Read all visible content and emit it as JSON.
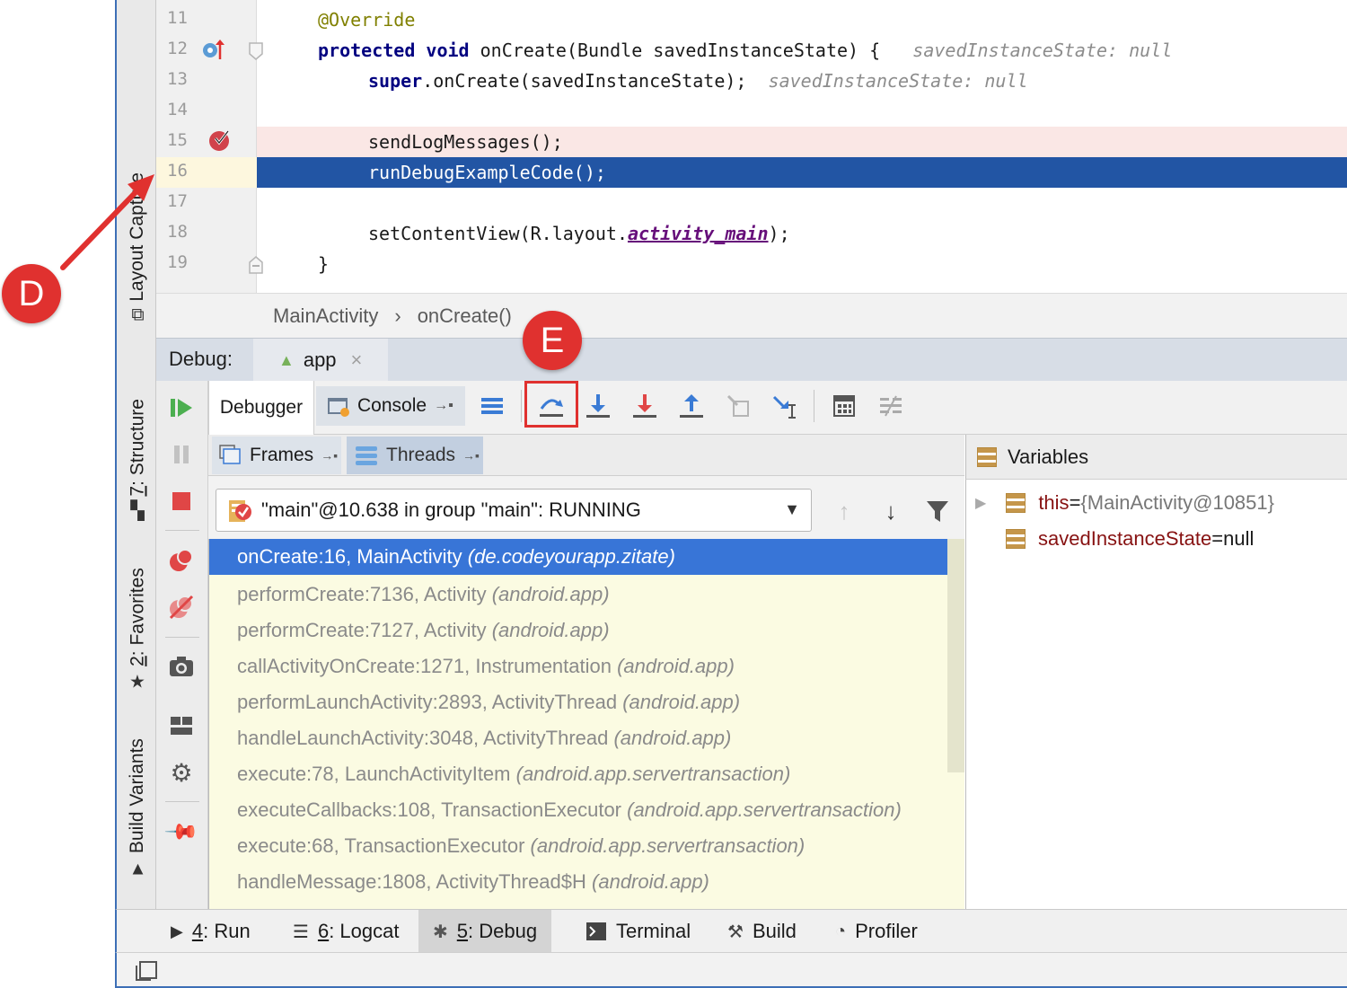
{
  "editor": {
    "lines": [
      {
        "num": "11",
        "text": "@Override"
      },
      {
        "num": "12",
        "kw1": "protected",
        "kw2": "void",
        "rest": " onCreate(Bundle savedInstanceState) {",
        "hint": "savedInstanceState: null"
      },
      {
        "num": "13",
        "kw1": "super",
        "rest": ".onCreate(savedInstanceState);",
        "hint": "savedInstanceState: null"
      },
      {
        "num": "14",
        "text": ""
      },
      {
        "num": "15",
        "text": "sendLogMessages();"
      },
      {
        "num": "16",
        "text": "runDebugExampleCode();"
      },
      {
        "num": "17",
        "text": ""
      },
      {
        "num": "18",
        "pre": "setContentView(R.layout.",
        "field": "activity_main",
        "post": ");"
      },
      {
        "num": "19",
        "text": "}"
      }
    ]
  },
  "breadcrumb": {
    "class": "MainActivity",
    "sep": "›",
    "method": "onCreate()"
  },
  "debug": {
    "label": "Debug:",
    "app_tab": "app",
    "tab_debugger": "Debugger",
    "tab_console": "Console",
    "tab_frames": "Frames",
    "tab_threads": "Threads",
    "thread": "\"main\"@10.638 in group \"main\": RUNNING",
    "frames": [
      {
        "method": "onCreate:16, MainActivity ",
        "pkg": "(de.codeyourapp.zitate)"
      },
      {
        "method": "performCreate:7136, Activity ",
        "pkg": "(android.app)"
      },
      {
        "method": "performCreate:7127, Activity ",
        "pkg": "(android.app)"
      },
      {
        "method": "callActivityOnCreate:1271, Instrumentation ",
        "pkg": "(android.app)"
      },
      {
        "method": "performLaunchActivity:2893, ActivityThread ",
        "pkg": "(android.app)"
      },
      {
        "method": "handleLaunchActivity:3048, ActivityThread ",
        "pkg": "(android.app)"
      },
      {
        "method": "execute:78, LaunchActivityItem ",
        "pkg": "(android.app.servertransaction)"
      },
      {
        "method": "executeCallbacks:108, TransactionExecutor ",
        "pkg": "(android.app.servertransaction)"
      },
      {
        "method": "execute:68, TransactionExecutor ",
        "pkg": "(android.app.servertransaction)"
      },
      {
        "method": "handleMessage:1808, ActivityThread$H ",
        "pkg": "(android.app)"
      }
    ],
    "variables_title": "Variables",
    "variables": [
      {
        "name": "this",
        "eq": " = ",
        "value": "{MainActivity@10851}"
      },
      {
        "name": "savedInstanceState",
        "eq": " = ",
        "value": "null"
      }
    ]
  },
  "side_tabs": {
    "layout_capture": "Layout Capture",
    "structure_num": "7",
    "structure": ": Structure",
    "favorites_num": "2",
    "favorites": ": Favorites",
    "build_variants": "Build Variants"
  },
  "bottom_tabs": [
    {
      "num": "4",
      "label": ": Run"
    },
    {
      "num": "6",
      "label": ": Logcat"
    },
    {
      "num": "5",
      "label": ": Debug"
    },
    {
      "num": "",
      "label": "Terminal"
    },
    {
      "num": "",
      "label": "Build"
    },
    {
      "num": "",
      "label": "Profiler"
    }
  ],
  "callouts": {
    "d": "D",
    "e": "E"
  },
  "colors": {
    "accent": "#e0312f",
    "selection": "#2255a4",
    "frame_selected": "#3875d7"
  }
}
